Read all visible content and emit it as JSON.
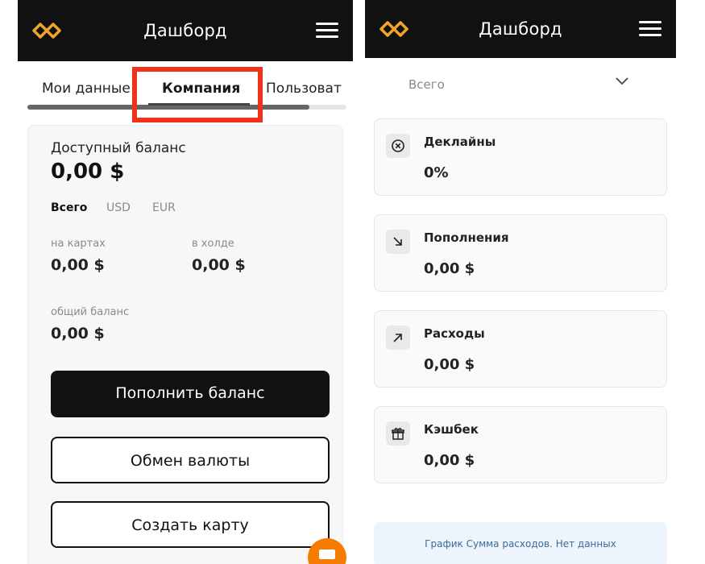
{
  "header": {
    "title": "Дашборд"
  },
  "tabs": [
    {
      "label": "Мои данные"
    },
    {
      "label": "Компания"
    },
    {
      "label": "Пользоват"
    }
  ],
  "balance": {
    "label": "Доступный баланс",
    "amount": "0,00 $",
    "currency_tabs": [
      "Всего",
      "USD",
      "EUR"
    ],
    "on_cards_label": "на картах",
    "on_cards_value": "0,00 $",
    "on_hold_label": "в холде",
    "on_hold_value": "0,00 $",
    "total_label": "общий баланс",
    "total_value": "0,00 $"
  },
  "buttons": {
    "topup": "Пополнить баланс",
    "exchange": "Обмен валюты",
    "create_card": "Создать карту"
  },
  "filter": {
    "selected": "Всего"
  },
  "stats": [
    {
      "label": "Деклайны",
      "value": "0%",
      "icon": "x-circle-icon"
    },
    {
      "label": "Пополнения",
      "value": "0,00 $",
      "icon": "arrow-down-right-icon"
    },
    {
      "label": "Расходы",
      "value": "0,00 $",
      "icon": "arrow-up-right-icon"
    },
    {
      "label": "Кэшбек",
      "value": "0,00 $",
      "icon": "gift-icon"
    }
  ],
  "chart_notice": "График Сумма расходов. Нет данных",
  "colors": {
    "header_bg": "#111111",
    "accent_logo": "#f0a52a",
    "highlight": "#f0321c",
    "fab": "#f57c00"
  }
}
